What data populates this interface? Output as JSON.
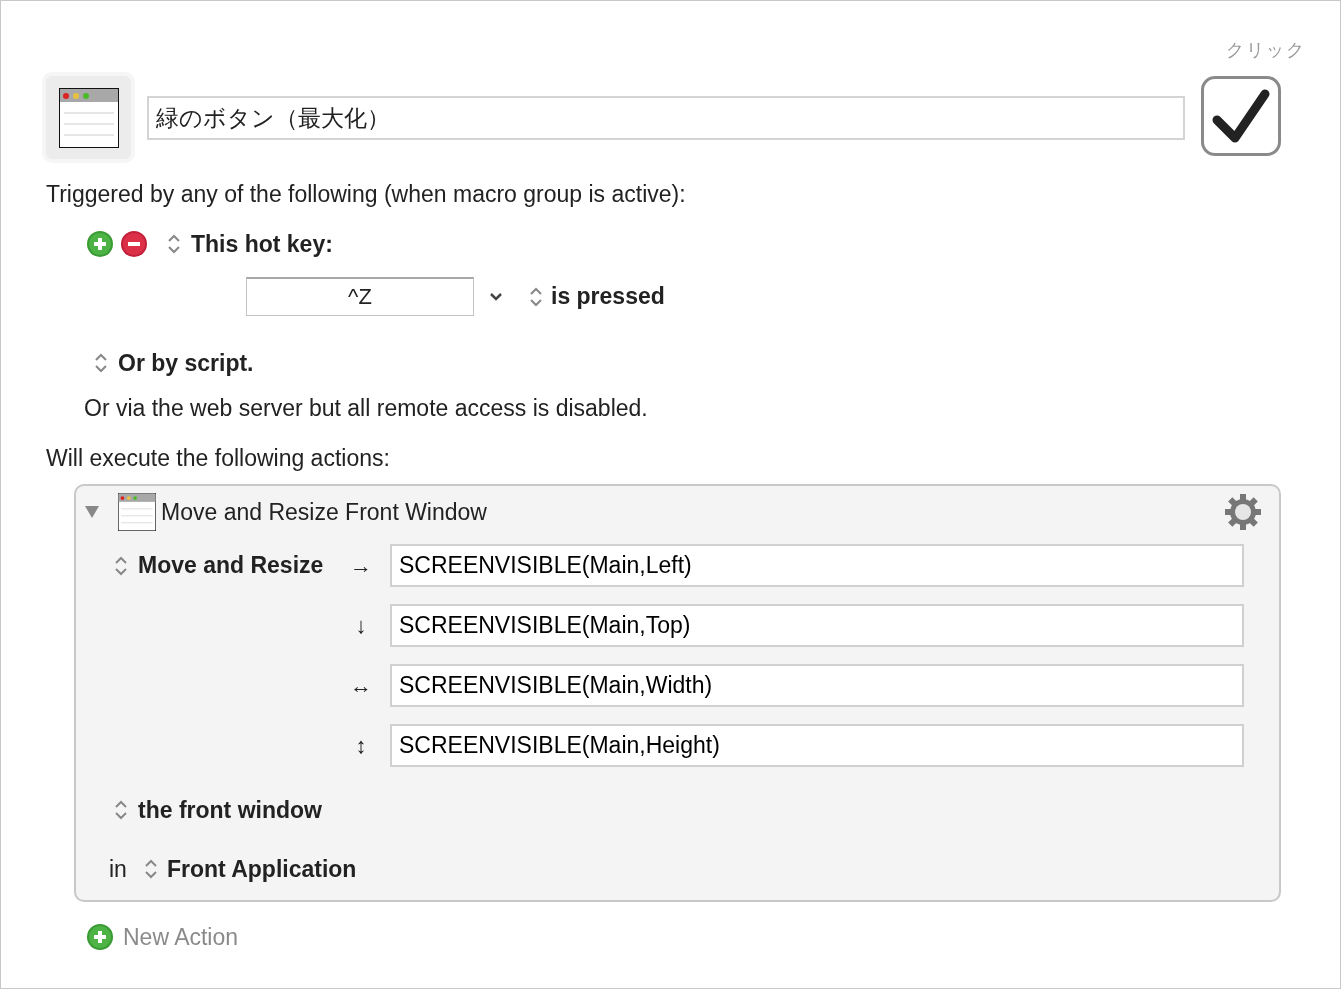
{
  "macro": {
    "name": "緑のボタン（最大化）",
    "enabled_label": "クリック",
    "enabled": true
  },
  "triggers": {
    "heading": "Triggered by any of the following (when macro group is active):",
    "hotkey": {
      "label": "This hot key:",
      "key": "^Z",
      "mode": "is pressed"
    },
    "script_label": "Or by script.",
    "web_server": "Or via the web server but all remote access is disabled."
  },
  "actions_heading": "Will execute the following actions:",
  "actions": [
    {
      "title": "Move and Resize Front Window",
      "expanded": true,
      "operation": "Move and Resize",
      "fields": [
        {
          "arrow": "→",
          "value": "SCREENVISIBLE(Main,Left)"
        },
        {
          "arrow": "↓",
          "value": "SCREENVISIBLE(Main,Top)"
        },
        {
          "arrow": "↔",
          "value": "SCREENVISIBLE(Main,Width)"
        },
        {
          "arrow": "↕",
          "value": "SCREENVISIBLE(Main,Height)"
        }
      ],
      "target": "the front window",
      "in_label": "in",
      "application": "Front Application"
    }
  ],
  "new_action": "New Action"
}
